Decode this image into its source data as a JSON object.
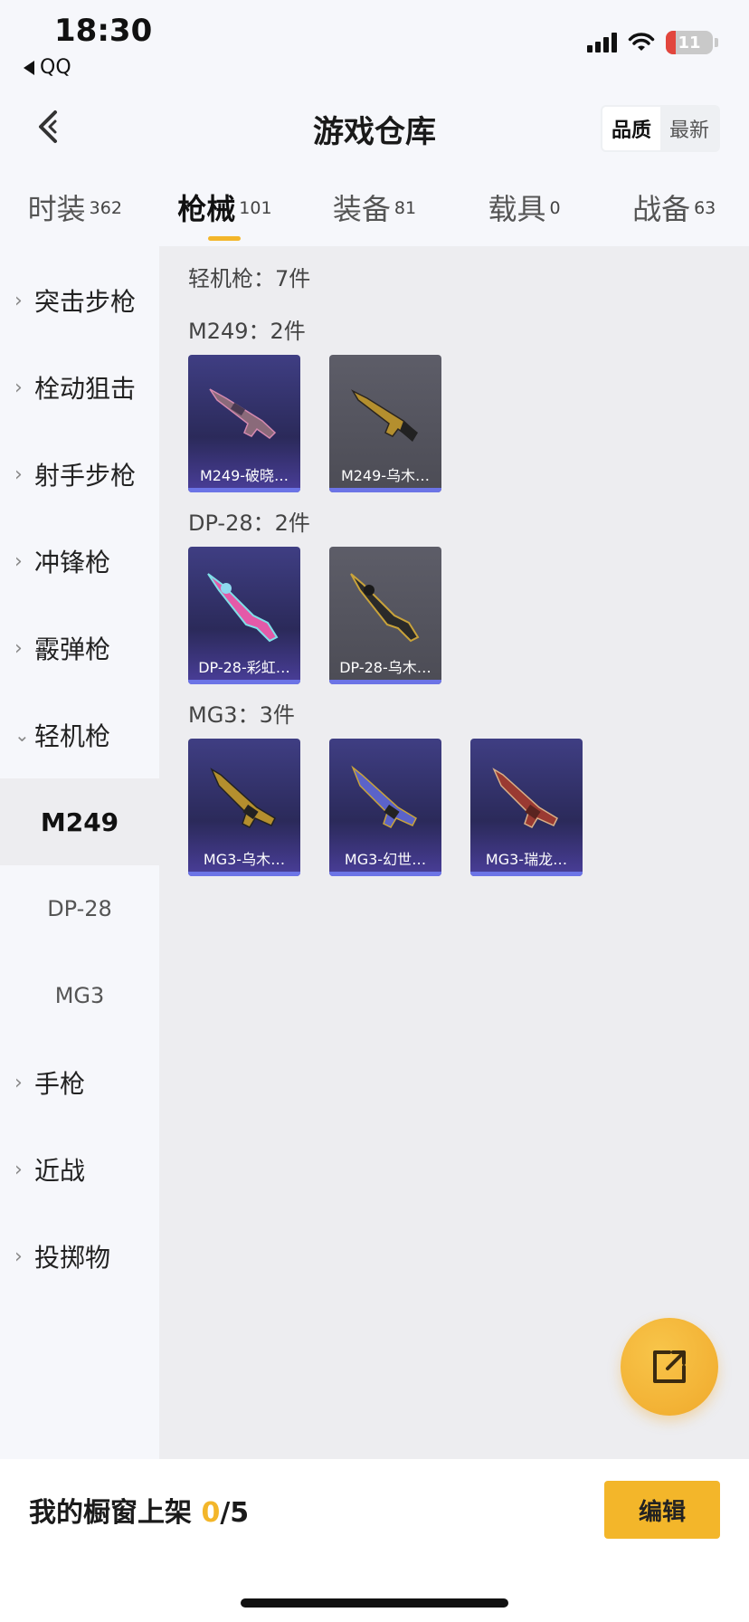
{
  "status_bar": {
    "time": "18:30",
    "back_app": "QQ",
    "battery": "11"
  },
  "header": {
    "title": "游戏仓库",
    "sort": {
      "quality": "品质",
      "newest": "最新"
    }
  },
  "tabs": [
    {
      "label": "时装",
      "count": "362"
    },
    {
      "label": "枪械",
      "count": "101"
    },
    {
      "label": "装备",
      "count": "81"
    },
    {
      "label": "载具",
      "count": "0"
    },
    {
      "label": "战备",
      "count": "63"
    }
  ],
  "sidebar": {
    "items": [
      "突击步枪",
      "栓动狙击",
      "射手步枪",
      "冲锋枪",
      "霰弹枪",
      "轻机枪",
      "手枪",
      "近战",
      "投掷物"
    ],
    "subitems": [
      "M249",
      "DP-28",
      "MG3"
    ]
  },
  "content": {
    "category_title": "轻机枪：7件",
    "groups": [
      {
        "title": "M249：2件",
        "cards": [
          "M249-破晓…",
          "M249-乌木…"
        ]
      },
      {
        "title": "DP-28：2件",
        "cards": [
          "DP-28-彩虹…",
          "DP-28-乌木…"
        ]
      },
      {
        "title": "MG3：3件",
        "cards": [
          "MG3-乌木…",
          "MG3-幻世…",
          "MG3-瑞龙…"
        ]
      }
    ]
  },
  "bottom": {
    "shelf_label": "我的橱窗上架 ",
    "shelf_current": "0",
    "shelf_total": "/5",
    "edit_label": "编辑"
  },
  "colors": {
    "accent": "#f3b62a",
    "card_purple": "#3f3e83",
    "card_gray": "#55555e",
    "card_bar": "#6c74e6"
  },
  "icons": {
    "back": "chevron-left-icon",
    "share": "share-external-icon",
    "sidebar_chevron": "chevron-right-icon",
    "sidebar_expanded": "chevron-down-icon"
  }
}
